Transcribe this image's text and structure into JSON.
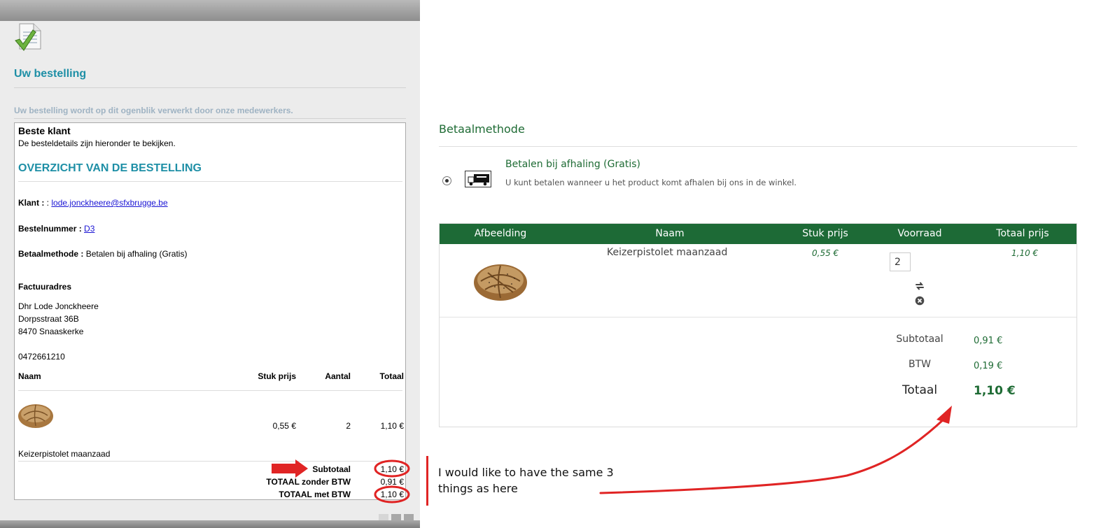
{
  "left_panel": {
    "title": "Uw bestelling",
    "subtitle": "Uw bestelling wordt op dit ogenblik verwerkt door onze medewerkers.",
    "mail": {
      "greeting": "Beste klant",
      "intro": "De besteldetails zijn hieronder te bekijken.",
      "overview_title": "OVERZICHT VAN DE BESTELLING",
      "klant_label": "Klant :",
      "klant_sep": " : ",
      "klant_email": "lode.jonckheere@sfxbrugge.be",
      "bestelnummer_label": "Bestelnummer :",
      "bestelnummer_value": "D3",
      "betaalmethode_label": "Betaalmethode :",
      "betaalmethode_value": "Betalen bij afhaling (Gratis)",
      "factuur_label": "Factuuradres",
      "address": [
        "Dhr Lode Jonckheere",
        "Dorpsstraat 36B",
        "8470 Snaaskerke"
      ],
      "phone": "0472661210",
      "table_headers": {
        "name": "Naam",
        "unit_price": "Stuk prijs",
        "qty": "Aantal",
        "total": "Totaal"
      },
      "item": {
        "unit_price": "0,55 €",
        "qty": "2",
        "total": "1,10 €",
        "name": "Keizerpistolet maanzaad"
      },
      "totals": [
        {
          "label": "Subtotaal",
          "value": "1,10 €"
        },
        {
          "label": "TOTAAL zonder BTW",
          "value": "0,91 €"
        },
        {
          "label": "TOTAAL met BTW",
          "value": "1,10 €"
        }
      ]
    }
  },
  "right_panel": {
    "payment_title": "Betaalmethode",
    "payment_option": {
      "name": "Betalen bij afhaling (Gratis)",
      "description": "U kunt betalen wanneer u het product komt afhalen bij ons in de winkel.",
      "selected": true
    },
    "cart_headers": [
      "Afbeelding",
      "Naam",
      "Stuk prijs",
      "Voorraad",
      "Totaal prijs"
    ],
    "cart_item": {
      "name": "Keizerpistolet maanzaad",
      "unit_price": "0,55 €",
      "quantity": "2",
      "total": "1,10 €"
    },
    "totals": [
      {
        "label": "Subtotaal",
        "value": "0,91 €"
      },
      {
        "label": "BTW",
        "value": "0,19 €"
      },
      {
        "label": "Totaal",
        "value": "1,10 €"
      }
    ]
  },
  "annotation": {
    "note": "I would like to have the same 3 things as here",
    "color": "#e02424"
  },
  "colors": {
    "teal": "#1e8fa6",
    "shop_green": "#1d6a36"
  }
}
